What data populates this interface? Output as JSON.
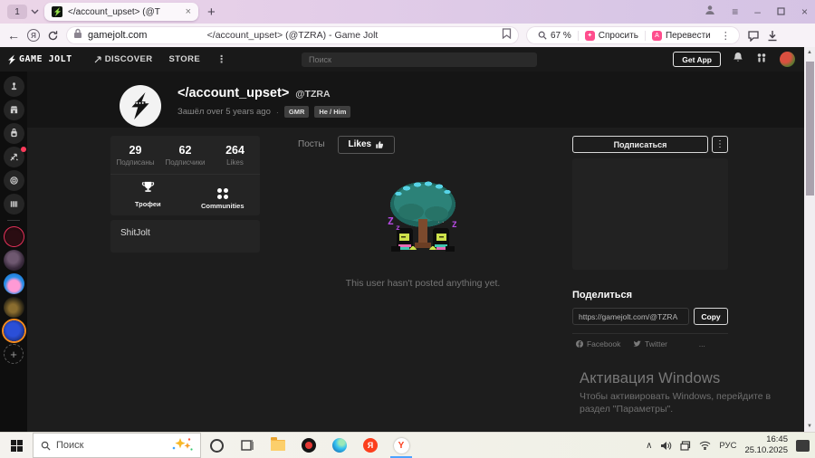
{
  "browser": {
    "tab_group_count": "1",
    "tab_title": "</account_upset> (@T",
    "url_host": "gamejolt.com",
    "page_title": "</account_upset> (@TZRA) - Game Jolt",
    "zoom_level": "67 %",
    "ask_label": "Спросить",
    "translate_label": "Перевести"
  },
  "icons": {
    "close": "×",
    "plus": "+",
    "minimize": "–",
    "menu": "≡",
    "back": "←",
    "more_v": "⋮",
    "dot": "·",
    "sb_up": "▲",
    "sb_down": "▼",
    "tray_up": "∧",
    "spark": "✦",
    "translate_letter": "А",
    "ya_letter": "Я",
    "yaw_letter": "Y",
    "ellipsis": "..."
  },
  "gj_header": {
    "logo": "GAME JOLT",
    "discover": "DISCOVER",
    "store": "STORE",
    "search_placeholder": "Поиск",
    "get_app": "Get App"
  },
  "profile": {
    "display_name": "</account_upset>",
    "username": "@TZRA",
    "last_seen": "Зашёл over 5 years ago",
    "badges": [
      {
        "label": "GMR"
      },
      {
        "label": "He / Him"
      }
    ],
    "stats": [
      {
        "value": "29",
        "label": "Подписаны"
      },
      {
        "value": "62",
        "label": "Подписчики"
      },
      {
        "value": "264",
        "label": "Likes"
      }
    ],
    "links": [
      {
        "label": "Трофеи"
      },
      {
        "label": "Communities"
      }
    ],
    "bio": "ShitJolt"
  },
  "tabs": {
    "posts": "Посты",
    "likes": "Likes"
  },
  "main": {
    "empty_text": "This user hasn't posted anything yet."
  },
  "panel": {
    "follow": "Подписаться",
    "share_title": "Поделиться",
    "share_url": "https://gamejolt.com/@TZRA",
    "copy": "Copy",
    "facebook": "Facebook",
    "twitter": "Twitter"
  },
  "watermark": {
    "title": "Активация Windows",
    "line1": "Чтобы активировать Windows, перейдите в",
    "line2": "раздел \"Параметры\"."
  },
  "taskbar": {
    "search_placeholder": "Поиск",
    "language": "РУС",
    "time": "16:45",
    "date": "25.10.2025"
  }
}
